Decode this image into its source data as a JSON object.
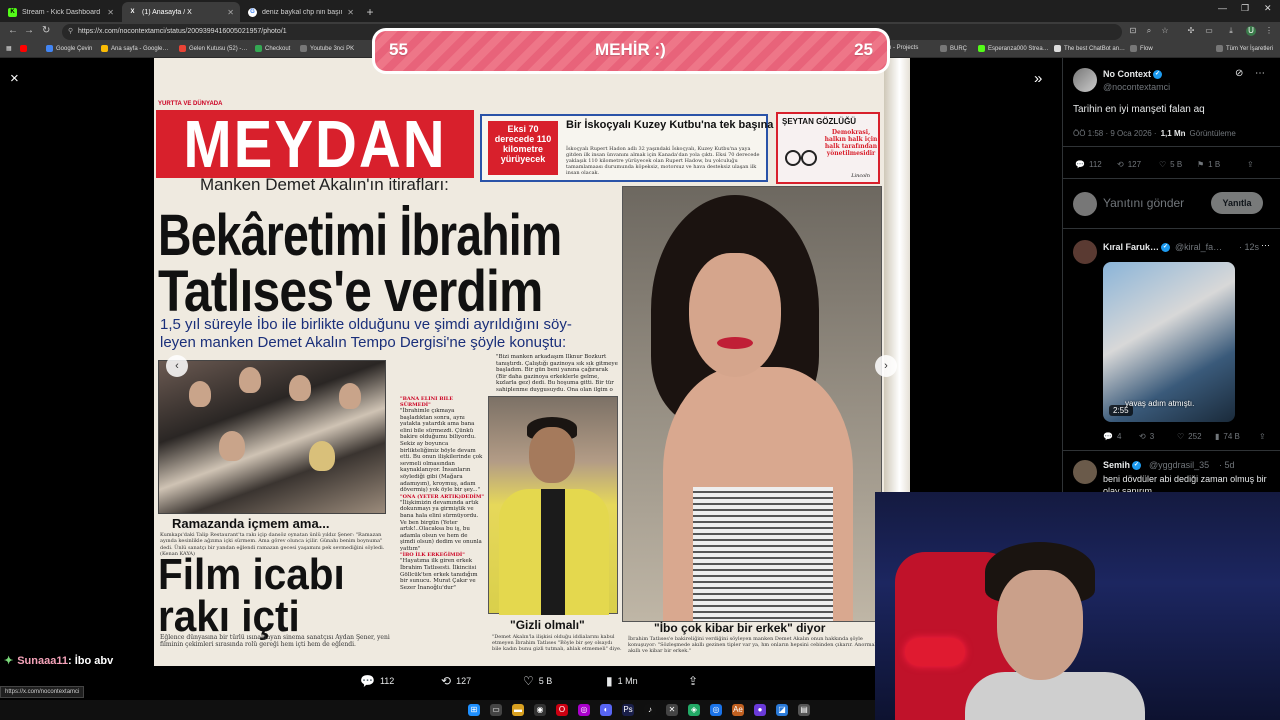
{
  "browser": {
    "tabs": [
      {
        "title": "Stream - Kick Dashboard",
        "favicon": "K",
        "color": "#53fc18",
        "active": false
      },
      {
        "title": "(1) Anasayfa / X",
        "favicon": "X",
        "color": "#ffffff",
        "active": true
      },
      {
        "title": "deniz baykal chp nin başında k…",
        "favicon": "G",
        "color": "#8ab4f8",
        "active": false
      }
    ],
    "new_tab": "+",
    "url": "https://x.com/nocontextamci/status/2009399416005021957/photo/1",
    "bookmarks": [
      "Google Çevin",
      "Ana sayfa - Google…",
      "Gelen Kutusu (52) -…",
      "Checkout",
      "Youtube 3nci PK",
      "Gen - Projects",
      "BURÇ",
      "Esperanza000 Strea…",
      "The best ChatBot an…",
      "Flow",
      "Tüm Yer İşaretleri"
    ],
    "status_url": "https://x.com/nocontextamci"
  },
  "overlay": {
    "left_value": "55",
    "title": "MEHİR :)",
    "right_value": "25"
  },
  "newspaper": {
    "kicker": "YURTTA VE DÜNYADA",
    "masthead": "MEYDAN",
    "promo_red": "Eksi 70 derecede 110 kilometre yürüyecek",
    "promo_headline": "Bir İskoçyalı Kuzey Kutbu'na tek başına yaya gidiyor",
    "promo_body": "İskoçyalı Rupert Hadon adlı 32 yaşındaki İskoçyalı, Kuzey Kutbu'na yaya gitden ilk insan ünvanını almak için Kanada'dan yola çıktı. Eksi 70 derecede yaklaşık 110 kilometre yürüyecek olan Rupert Hadow, bu yolculuğu tamamlamaası durumunda köpeksiz, motorsuz ve hava desteksiz ulaşan ilk insan olacak.",
    "seytan_title": "ŞEYTAN GÖZLÜĞÜ",
    "seytan_body": "Demokrasi, halkın halk için halk tarafından yönetilmesidir",
    "seytan_sig": "Lincoln",
    "subhead": "Manken Demet Akalın'ın itirafları:",
    "headline1": "Bekâretimi İbrahim",
    "headline2": "Tatlıses'e verdim",
    "deck1": "1,5 yıl süreyle İbo ile birlikte olduğunu ve şimdi ayrıldığını söy-",
    "deck2": "leyen manken Demet Akalın Tempo Dergisi'ne şöyle konuştu:",
    "caption_a": "Ramazanda içmem ama...",
    "body_a": "Kumkapı'daki Talip Restaurant'ta rakı içip dansöz oynatan ünlü yıldız Şener: \"Ramazan ayında kesinlikle ağzıma içki sürmem. Ama görev olunca içilir. Günahı benim boynuma\" dedi. Ünlü sanatçı bir yandan eğlendi ramazan gecesi yaşamını pek sevmediğini söyledi. (Kenan KAYA)",
    "film1": "Film icabı",
    "film2": "rakı içti",
    "body_b": "Eğlence dünyasına bir türlü ısınamayan sinema sanatçısı Aydan Şener, yeni filminin çekimleri sırasında rolü gereği hem içti hem de eğlendi.",
    "col1": "\"Bizi manken arkadaşım İlknur Bozkurt tanıştırdı. Çalıştığı gazinoya sık sık gitmeye başladım. Bir gün beni yanına çağırarak (Bir daha gazinoya erkeklerle gelme, kızlarla gez) dedi. Bu hoşuma gitti. Bir tür sahiplenme duygusuydu. Ona olan ilgim o günden sonra arttı\"",
    "col1_label": "\"BANA ELİNİ BİLE SÜRMEDİ\"",
    "col2": "\"İbrahimle çıkmaya başladıktan sonra, aynı yatakta yatardık ama bana elini bile sürmezdi. Çünkü bakire olduğumu biliyordu. Sekiz ay boyunca birlikteliğimiz böyle devam etti. Bu onun ilişkilerinde çok sevmeli olmasından kaynaklanıyor. İnsanların söylediği gibi (Mağara adamıyım), kroymuş, adam dövermiş) yok öyle bir şey...\"",
    "col2_label": "\"ONA (YETER ARTIK)DEDİM\"",
    "col2b": "\"İlişkimizin devamında artık dokunmayı ya girmiştik ve bana hala elini sürmüyordu. Ve ben birgün (Yeter artık!..Olacaksa bu iş, bu adamla olsun ve hem de şimdi olsun) dedim ve onunla yattım\"",
    "col2_label2": "\"İBO İLK ERKEĞİMDİ\"",
    "col2c": "\"Hayatıma ilk giren erkek İbrahim Tatlısesti. İlkinciisi Göllcük'ten erkek tanıdığım bir sunucu. Murat Çakır ve Sezer İnanoğlu'dur\"",
    "caption_b": "\"Gizli olmalı\"",
    "body_c": "\"Demet Akalın'la ilişkisi olduğu iddialarını kabul etmeyen İbrahim Tatlıses \"Böyle bir şey olsaydı bile kadın bunu gizli tutmalı, ahlak etmemeli\" diye.",
    "caption_c": "\"İbo çok kibar bir erkek\" diyor",
    "body_d": "İbrahim Tatlıses'e bakireliğini verdiğini söyleyen manken Demet Akalın onun hakkında şöyle konuşuyor: \"Sözleşmede akıllı gezinen tipler var ya, hm onların hepsini cebinden çıkarır. Anormal akıllı ve kibar bir erkek.\""
  },
  "viewer": {
    "close_icon": "×",
    "collapse_icon": "»",
    "prev_icon": "‹",
    "next_icon": "›",
    "replies": "112",
    "reposts": "127",
    "likes": "5 B",
    "views": "1 Mn"
  },
  "panel": {
    "author_name": "No Context",
    "author_handle": "@nocontextamci",
    "tweet_text": "Tarihin en iyi manşeti falan aq",
    "meta_time": "ÖÖ 1:58 · 9 Oca 2026 ·",
    "meta_views": "1,1 Mn",
    "meta_views_label": "Görüntüleme",
    "stats": {
      "replies": "112",
      "reposts": "127",
      "likes": "5 B",
      "bookmarks": "1 B"
    },
    "reply_placeholder": "Yanıtını gönder",
    "reply_button": "Yanıtla",
    "reply1": {
      "name": "Kıral Faruk…",
      "handle": "@kiral_fa…",
      "time": "· 12s",
      "video_duration": "2:55",
      "video_caption": "yavaş adım atmıştı.",
      "stats": {
        "replies": "4",
        "reposts": "3",
        "likes": "252",
        "views": "74 B"
      }
    },
    "reply2": {
      "name": "Semih",
      "handle": "@yggdrasil_35",
      "time": "· 5d",
      "text": "beni dövdüler abi dediği zaman olmuş bir olay sanırım"
    }
  },
  "chat": {
    "user": "Sunaaa11",
    "message": ": İbo abv"
  },
  "colors": {
    "accent": "#1d9bf0",
    "masthead_red": "#d8202c",
    "overlay_pink": "#e8637a"
  }
}
